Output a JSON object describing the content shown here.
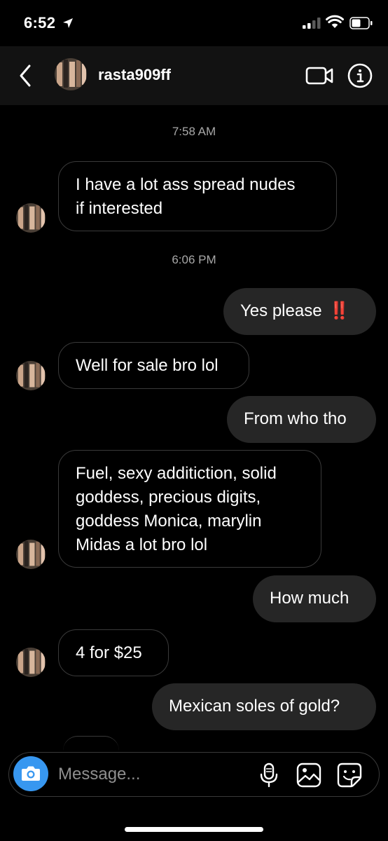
{
  "status_bar": {
    "time": "6:52"
  },
  "header": {
    "username": "rasta909ff"
  },
  "messages": [
    {
      "type": "timestamp",
      "text": "7:58 AM"
    },
    {
      "type": "incoming",
      "lines": [
        "I have a lot ass spread nudes",
        "if interested"
      ]
    },
    {
      "type": "timestamp",
      "text": "6:06 PM"
    },
    {
      "type": "outgoing",
      "text": "Yes please",
      "emoji": "‼️"
    },
    {
      "type": "incoming",
      "lines": [
        "Well for sale bro lol"
      ]
    },
    {
      "type": "outgoing",
      "text": "From who tho"
    },
    {
      "type": "incoming",
      "lines": [
        "Fuel, sexy additiction, solid",
        "goddess, precious digits,",
        "goddess Monica, marylin",
        "Midas a lot bro lol"
      ]
    },
    {
      "type": "outgoing",
      "text": "How much"
    },
    {
      "type": "incoming",
      "lines": [
        "4 for $25"
      ]
    },
    {
      "type": "outgoing",
      "text": "Mexican soles of gold?"
    }
  ],
  "composer": {
    "placeholder": "Message..."
  },
  "colors": {
    "background": "#000000",
    "header": "#121212",
    "outgoing_bubble": "#262626",
    "incoming_border": "#3a3a3a",
    "camera_button": "#3797f0",
    "timestamp": "#a8a8a8"
  }
}
